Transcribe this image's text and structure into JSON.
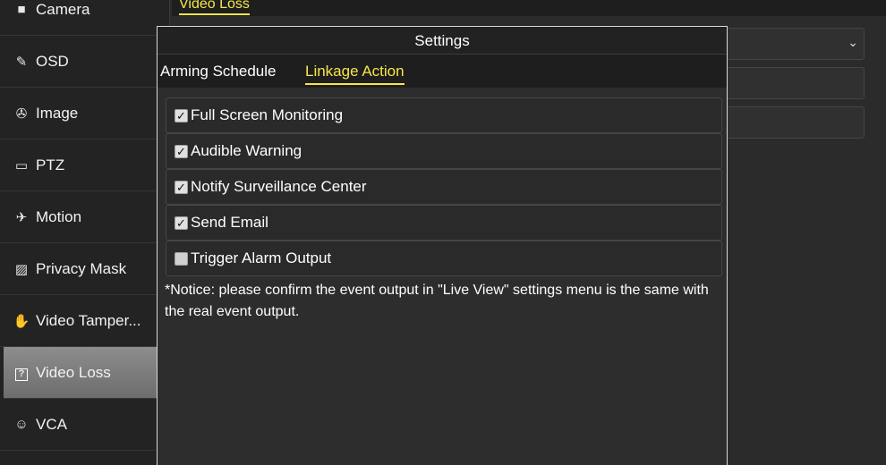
{
  "sidebar": {
    "items": [
      {
        "label": "Camera",
        "icon": "camera-icon",
        "glyph": "■"
      },
      {
        "label": "OSD",
        "icon": "osd-pen-icon",
        "glyph": "✎"
      },
      {
        "label": "Image",
        "icon": "image-aperture-icon",
        "glyph": "✇"
      },
      {
        "label": "PTZ",
        "icon": "ptz-dome-icon",
        "glyph": "▭"
      },
      {
        "label": "Motion",
        "icon": "motion-runner-icon",
        "glyph": "✈"
      },
      {
        "label": "Privacy Mask",
        "icon": "privacy-mask-icon",
        "glyph": "▨"
      },
      {
        "label": "Video Tamper...",
        "icon": "hand-icon",
        "glyph": "✋"
      },
      {
        "label": "Video Loss",
        "icon": "video-loss-icon",
        "glyph": "?"
      },
      {
        "label": "VCA",
        "icon": "vca-head-icon",
        "glyph": "☺"
      }
    ],
    "active": "Video Loss"
  },
  "main": {
    "tab_label": "Video Loss"
  },
  "dialog": {
    "title": "Settings",
    "tabs": [
      {
        "label": "Arming Schedule"
      },
      {
        "label": "Linkage Action"
      }
    ],
    "active_tab": "Linkage Action",
    "options": [
      {
        "label": "Full Screen Monitoring",
        "checked": true
      },
      {
        "label": "Audible Warning",
        "checked": true
      },
      {
        "label": "Notify Surveillance Center",
        "checked": true
      },
      {
        "label": "Send Email",
        "checked": true
      },
      {
        "label": "Trigger Alarm Output",
        "checked": false
      }
    ],
    "notice": "*Notice: please confirm the event output in \"Live View\" settings menu is the same with the real event output."
  },
  "colors": {
    "accent": "#f5e64a",
    "sidebar_active": "#7d7d7d",
    "background": "#2b2b2b"
  }
}
